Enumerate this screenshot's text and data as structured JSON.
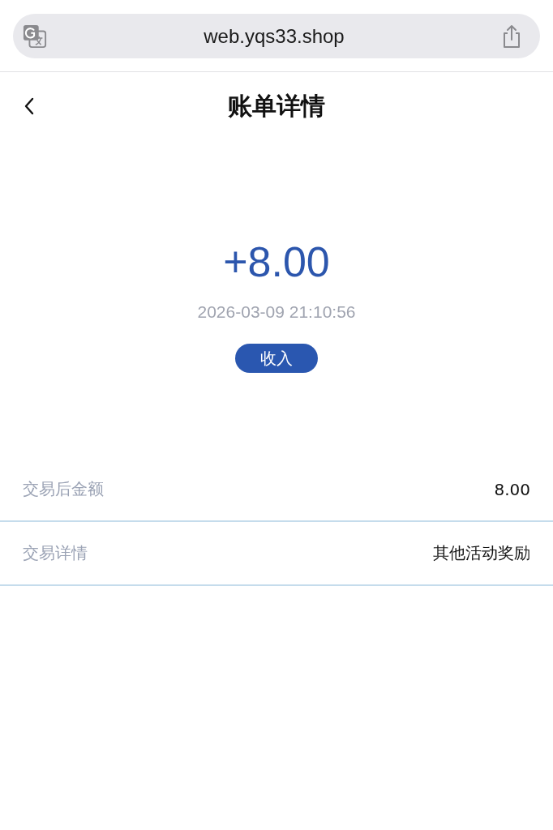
{
  "browser": {
    "url": "web.yqs33.shop"
  },
  "header": {
    "title": "账单详情"
  },
  "summary": {
    "amount": "+8.00",
    "time": "2026-03-09 21:10:56",
    "type_badge": "收入"
  },
  "rows": [
    {
      "label": "交易后金额",
      "value": "8.00"
    },
    {
      "label": "交易详情",
      "value": "其他活动奖励"
    }
  ]
}
